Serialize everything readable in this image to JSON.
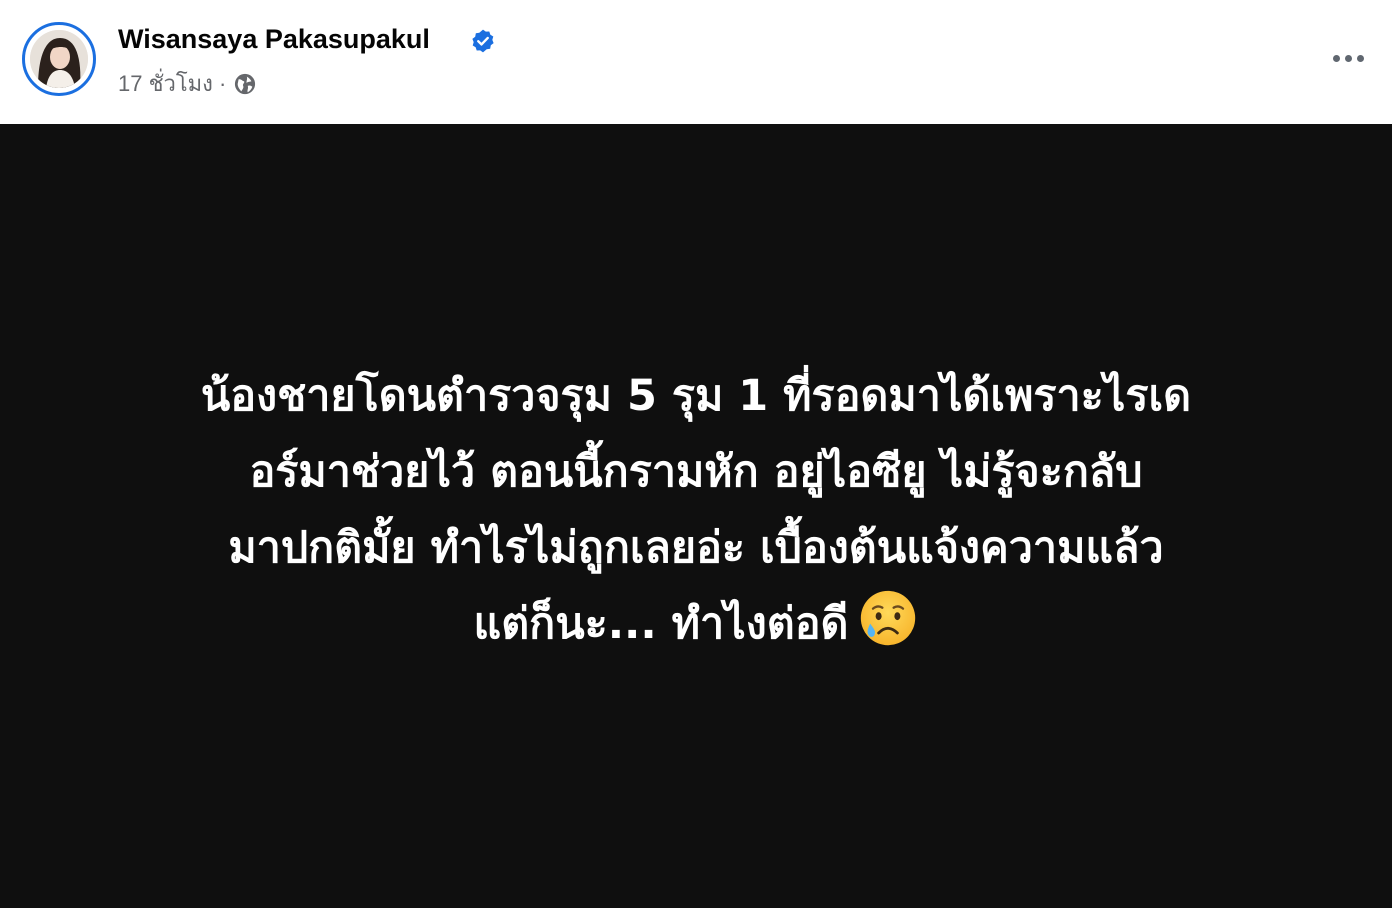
{
  "post": {
    "author_name": "Wisansaya Pakasupakul",
    "verified": true,
    "timestamp": "17 ชั่วโมง",
    "separator": "·",
    "privacy_icon": "globe-icon",
    "more_icon": "more-options-icon",
    "body_lines": [
      "น้องชายโดนตำรวจรุม 5 รุม 1 ที่รอดมาได้เพราะไรเด",
      "อร์มาช่วยไว้ ตอนนี้กรามหัก อยู่ไอซียู ไม่รู้จะกลับ",
      "มาปกติมั้ย ทำไรไม่ถูกเลยอ่ะ เบื้องต้นแจ้งความแล้ว",
      "แต่ก็นะ... ทำไงต่อดี"
    ],
    "emoji": "sad-but-relieved-face"
  },
  "colors": {
    "verified_blue": "#1b6fe0",
    "image_background": "#0f0f0f",
    "text_primary": "#050505",
    "text_secondary": "#65676b"
  }
}
